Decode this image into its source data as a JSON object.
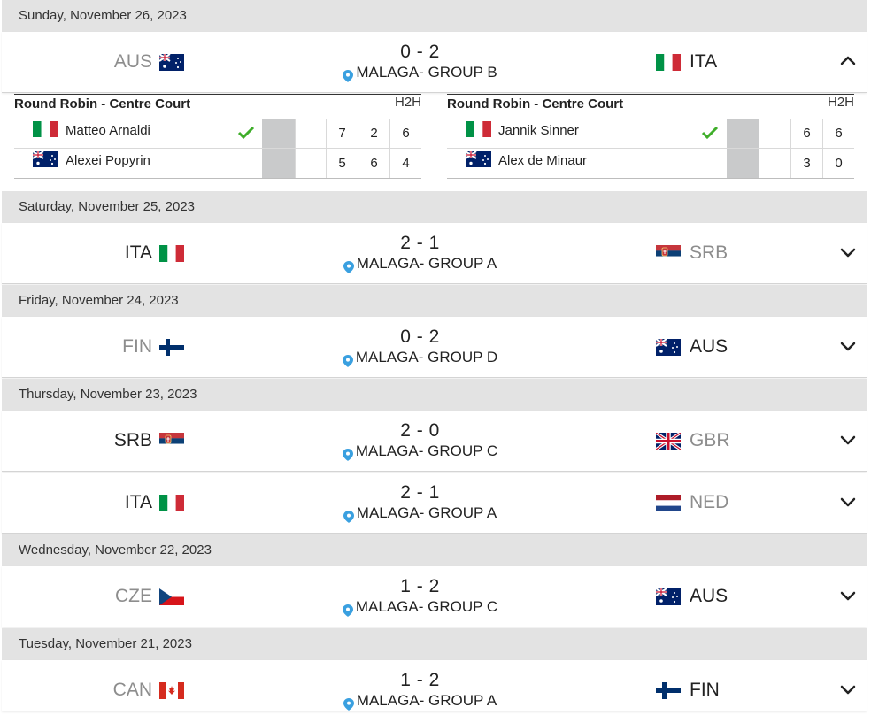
{
  "colors": {
    "date_bg": "#e3e3e3",
    "check": "#3fae2a",
    "pin": "#3aa0e0",
    "win_text": "#222222",
    "lose_text": "#8d8d8d"
  },
  "groups": [
    {
      "date": "Sunday, November 26, 2023",
      "ties": [
        {
          "home": {
            "code": "AUS",
            "flag": "australia-flag",
            "winner": false
          },
          "score": "0 - 2",
          "venue": "MALAGA- GROUP B",
          "away": {
            "code": "ITA",
            "flag": "italy-flag",
            "winner": true
          },
          "expanded": true,
          "rubbers": [
            {
              "title": "Round Robin - Centre Court",
              "h2h": "H2H",
              "players": [
                {
                  "name": "Matteo Arnaldi",
                  "flag": "italy-flag",
                  "winner": true,
                  "sets": [
                    "7",
                    "2",
                    "6"
                  ]
                },
                {
                  "name": "Alexei Popyrin",
                  "flag": "australia-flag",
                  "winner": false,
                  "sets": [
                    "5",
                    "6",
                    "4"
                  ]
                }
              ]
            },
            {
              "title": "Round Robin - Centre Court",
              "h2h": "H2H",
              "players": [
                {
                  "name": "Jannik Sinner",
                  "flag": "italy-flag",
                  "winner": true,
                  "sets": [
                    "6",
                    "6"
                  ]
                },
                {
                  "name": "Alex de Minaur",
                  "flag": "australia-flag",
                  "winner": false,
                  "sets": [
                    "3",
                    "0"
                  ]
                }
              ]
            }
          ]
        }
      ]
    },
    {
      "date": "Saturday, November 25, 2023",
      "ties": [
        {
          "home": {
            "code": "ITA",
            "flag": "italy-flag",
            "winner": true
          },
          "score": "2 - 1",
          "venue": "MALAGA- GROUP A",
          "away": {
            "code": "SRB",
            "flag": "serbia-flag",
            "winner": false
          },
          "expanded": false
        }
      ]
    },
    {
      "date": "Friday, November 24, 2023",
      "ties": [
        {
          "home": {
            "code": "FIN",
            "flag": "finland-flag",
            "winner": false
          },
          "score": "0 - 2",
          "venue": "MALAGA- GROUP D",
          "away": {
            "code": "AUS",
            "flag": "australia-flag",
            "winner": true
          },
          "expanded": false
        }
      ]
    },
    {
      "date": "Thursday, November 23, 2023",
      "ties": [
        {
          "home": {
            "code": "SRB",
            "flag": "serbia-flag",
            "winner": true
          },
          "score": "2 - 0",
          "venue": "MALAGA- GROUP C",
          "away": {
            "code": "GBR",
            "flag": "great-britain-flag",
            "winner": false
          },
          "expanded": false
        },
        {
          "home": {
            "code": "ITA",
            "flag": "italy-flag",
            "winner": true
          },
          "score": "2 - 1",
          "venue": "MALAGA- GROUP A",
          "away": {
            "code": "NED",
            "flag": "netherlands-flag",
            "winner": false
          },
          "expanded": false
        }
      ]
    },
    {
      "date": "Wednesday, November 22, 2023",
      "ties": [
        {
          "home": {
            "code": "CZE",
            "flag": "czechia-flag",
            "winner": false
          },
          "score": "1 - 2",
          "venue": "MALAGA- GROUP C",
          "away": {
            "code": "AUS",
            "flag": "australia-flag",
            "winner": true
          },
          "expanded": false
        }
      ]
    },
    {
      "date": "Tuesday, November 21, 2023",
      "ties": [
        {
          "home": {
            "code": "CAN",
            "flag": "canada-flag",
            "winner": false
          },
          "score": "1 - 2",
          "venue": "MALAGA- GROUP A",
          "away": {
            "code": "FIN",
            "flag": "finland-flag",
            "winner": true
          },
          "expanded": false
        }
      ]
    }
  ]
}
